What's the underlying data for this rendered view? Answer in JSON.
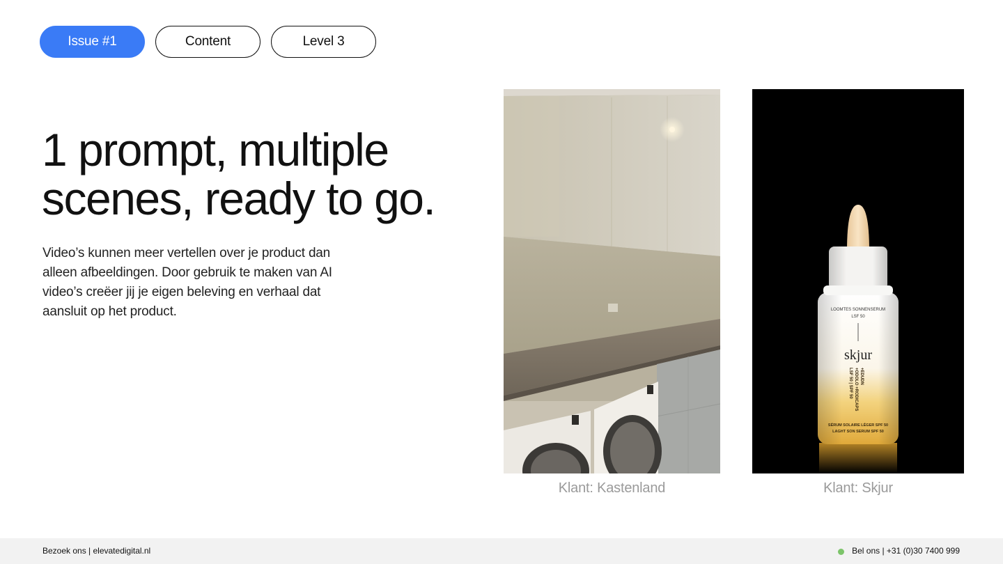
{
  "tags": {
    "issue": "Issue #1",
    "category": "Content",
    "level": "Level 3"
  },
  "headline": {
    "line1": "1 prompt, multiple",
    "line2": "scenes, ready to go."
  },
  "body_text": "Video’s kunnen meer vertellen over je product dan alleen afbeeldingen. Door gebruik te maken van AI video’s creëer jij je eigen beleving en verhaal dat aansluit op het product.",
  "gallery": {
    "item1_caption": "Klant: Kastenland",
    "item2_caption": "Klant: Skjur",
    "product_label": {
      "top1": "LOOMTES SONNENSERUM",
      "top2": "LSF 50",
      "brand": "skjur",
      "side1": "LSF 50 | SPF 50",
      "side2": "+ODOLO +RODICAPS",
      "side3": "+EDUDN",
      "bottom1": "SÉRUM SOLAIRE LÉGER SPF 50",
      "bottom2": "LAGHT SON SERUM SPF 50"
    }
  },
  "footer": {
    "visit": "Bezoek ons | elevatedigital.nl",
    "call": "Bel ons | +31 (0)30 7400 999"
  },
  "colors": {
    "accent": "#3a7bf6",
    "status_dot": "#7cc46a",
    "caption": "#9a9a9a",
    "footer_bg": "#f2f2f2"
  }
}
